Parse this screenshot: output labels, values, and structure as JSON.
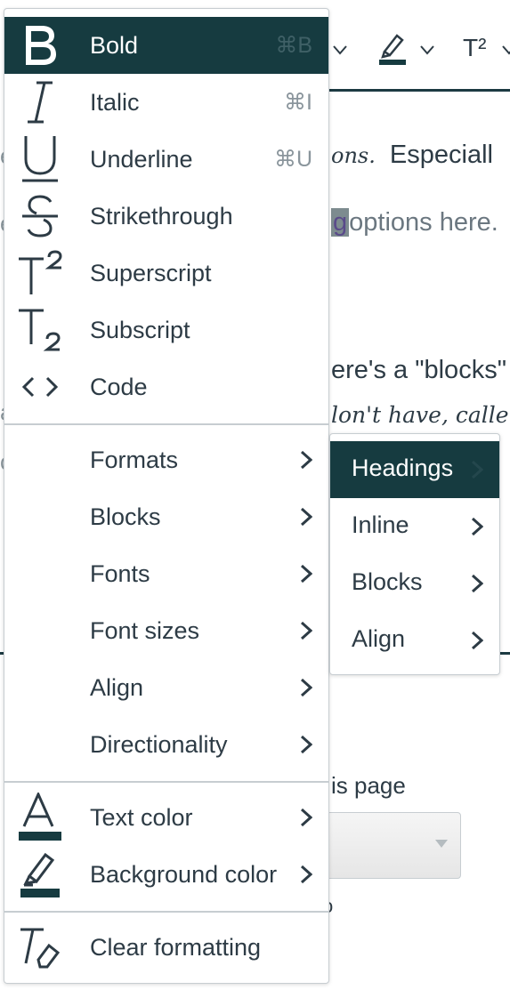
{
  "background": {
    "toolbar_superscript": "T²",
    "line1_handwritten": "ons.",
    "line1_text": "Especiall",
    "line2_highlight": "g",
    "line2_text": "options here.",
    "line3_text": "ere's a \"blocks\"",
    "line4_handwritten": "lon't have, calle",
    "left_frag_1": "e",
    "left_frag_2": "e",
    "left_frag_3": "a",
    "left_frag_4": "c",
    "page_label": "is page",
    "small_text": "o"
  },
  "menu": {
    "items": [
      {
        "label": "Bold",
        "shortcut": "⌘B",
        "icon": "bold-icon"
      },
      {
        "label": "Italic",
        "shortcut": "⌘I",
        "icon": "italic-icon"
      },
      {
        "label": "Underline",
        "shortcut": "⌘U",
        "icon": "underline-icon"
      },
      {
        "label": "Strikethrough",
        "shortcut": "",
        "icon": "strikethrough-icon"
      },
      {
        "label": "Superscript",
        "shortcut": "",
        "icon": "superscript-icon"
      },
      {
        "label": "Subscript",
        "shortcut": "",
        "icon": "subscript-icon"
      },
      {
        "label": "Code",
        "shortcut": "",
        "icon": "code-icon"
      }
    ],
    "submenus": [
      {
        "label": "Formats"
      },
      {
        "label": "Blocks"
      },
      {
        "label": "Fonts"
      },
      {
        "label": "Font sizes"
      },
      {
        "label": "Align"
      },
      {
        "label": "Directionality"
      }
    ],
    "colors": [
      {
        "label": "Text color",
        "icon": "text-color-icon"
      },
      {
        "label": "Background color",
        "icon": "background-color-icon"
      }
    ],
    "clear": {
      "label": "Clear formatting",
      "icon": "clear-formatting-icon"
    }
  },
  "formats_submenu": {
    "items": [
      {
        "label": "Headings"
      },
      {
        "label": "Inline"
      },
      {
        "label": "Blocks"
      },
      {
        "label": "Align"
      }
    ]
  },
  "colors_theme": {
    "active_bg": "#163b40",
    "text": "#2d3b45",
    "border": "#c7cdd1"
  }
}
